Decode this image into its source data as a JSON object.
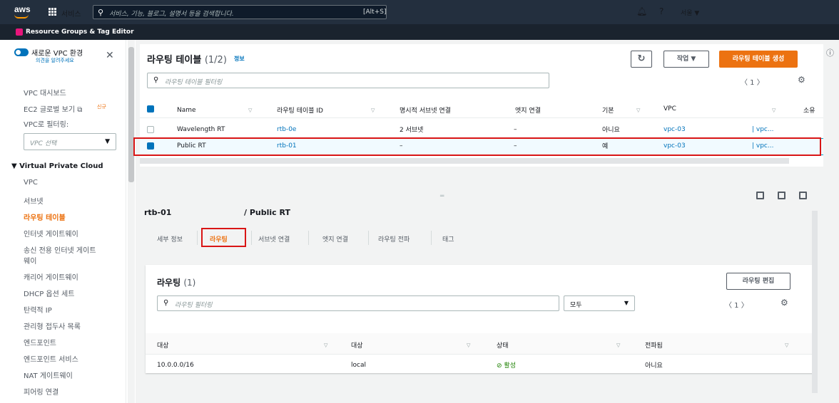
{
  "topnav": {
    "logo": "aws",
    "services": "서비스",
    "search_placeholder": "서비스, 기능, 블로그, 설명서 등을 검색합니다.",
    "search_kbd": "[Alt+S]",
    "region": "서울 ▼"
  },
  "resource_bar": {
    "label": "Resource Groups & Tag Editor"
  },
  "sidebar": {
    "new_vpc": "새로운 VPC 환경",
    "feedback": "의견을 알려주세요",
    "dashboard": "VPC 대시보드",
    "ec2_global": "EC2 글로벌 보기",
    "new_badge": "신규",
    "filter_label": "VPC로 필터링:",
    "vpc_select_placeholder": "VPC 선택",
    "section": "▼ Virtual Private Cloud",
    "items": [
      "VPC",
      "서브넷",
      "라우팅 테이블",
      "인터넷 게이트웨이",
      "송신 전용 인터넷 게이트",
      "웨이",
      "캐리어 게이트웨이",
      "DHCP 옵션 세트",
      "탄력적 IP",
      "관리형 접두사 목록",
      "엔드포인트",
      "엔드포인트 서비스",
      "NAT 게이트웨이",
      "피어링 연결"
    ]
  },
  "route_tables": {
    "title": "라우팅 테이블",
    "count": "(1/2)",
    "info": "정보",
    "actions_label": "작업 ▼",
    "create_label": "라우팅 테이블 생성",
    "filter_placeholder": "라우팅 테이블 필터링",
    "pager": "〈  1  〉",
    "columns": [
      "Name",
      "라우팅 테이블 ID",
      "명시적 서브넷 연결",
      "엣지 연결",
      "기본",
      "VPC",
      "소유"
    ],
    "rows": [
      {
        "name": "Wavelength RT",
        "id": "rtb-0e",
        "subnet": "2 서브넷",
        "edge": "–",
        "main": "아니요",
        "vpc": "vpc-03",
        "owner": "| vpc..."
      },
      {
        "name": "Public RT",
        "id": "rtb-01",
        "subnet": "–",
        "edge": "–",
        "main": "예",
        "vpc": "vpc-03",
        "owner": "| vpc..."
      }
    ]
  },
  "detail": {
    "id": "rtb-01",
    "name": "/ Public RT",
    "tabs": [
      "세부 정보",
      "라우팅",
      "서브넷 연결",
      "엣지 연결",
      "라우팅 전파",
      "태그"
    ],
    "routes": {
      "title": "라우팅",
      "count": "(1)",
      "edit_label": "라우팅 편집",
      "filter_placeholder": "라우팅 필터링",
      "select_value": "모두",
      "pager": "〈  1  〉",
      "columns": [
        "대상",
        "대상",
        "상태",
        "전파됨"
      ],
      "rows": [
        {
          "destination": "10.0.0.0/16",
          "target": "local",
          "status": "활성",
          "propagated": "아니요"
        }
      ]
    }
  }
}
